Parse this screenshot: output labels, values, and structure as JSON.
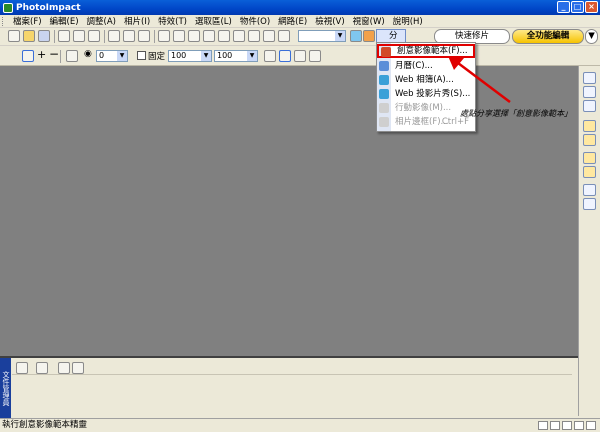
{
  "window": {
    "title": "PhotoImpact",
    "buttons": [
      "_",
      "□",
      "×"
    ]
  },
  "menu": [
    "檔案(F)",
    "編輯(E)",
    "調整(A)",
    "相片(I)",
    "特效(T)",
    "選取區(L)",
    "物件(O)",
    "網路(E)",
    "檢視(V)",
    "視窗(W)",
    "說明(H)"
  ],
  "toolbar": {
    "share_label": "分享",
    "quick_photo": "快速修片",
    "full_edit": "全功能編輯"
  },
  "attrbar": {
    "angle_value": "0",
    "fixed_label": "固定",
    "width_value": "100",
    "height_value": "100"
  },
  "share_menu": {
    "items": [
      {
        "label": "創意影像範本(F)...",
        "shortcut": "",
        "disabled": false,
        "highlighted": true
      },
      {
        "label": "月曆(C)...",
        "shortcut": "",
        "disabled": false,
        "highlighted": false
      },
      {
        "label": "Web 相簿(A)...",
        "shortcut": "",
        "disabled": false,
        "highlighted": false
      },
      {
        "label": "Web 投影片秀(S)...",
        "shortcut": "",
        "disabled": false,
        "highlighted": false
      },
      {
        "label": "行動影像(M)...",
        "shortcut": "",
        "disabled": true,
        "highlighted": false
      },
      {
        "label": "相片邊框(F)...",
        "shortcut": "Ctrl+F",
        "disabled": true,
        "highlighted": false
      }
    ]
  },
  "annotation": "處點分享選擇「創意影像範本」",
  "bottom_panel": {
    "side_label": "文件管理員"
  },
  "status": {
    "text": "執行創意影像範本精靈"
  },
  "colors": {
    "accent": "#0046c7",
    "highlight": "#e00000",
    "workspace": "#808080"
  }
}
